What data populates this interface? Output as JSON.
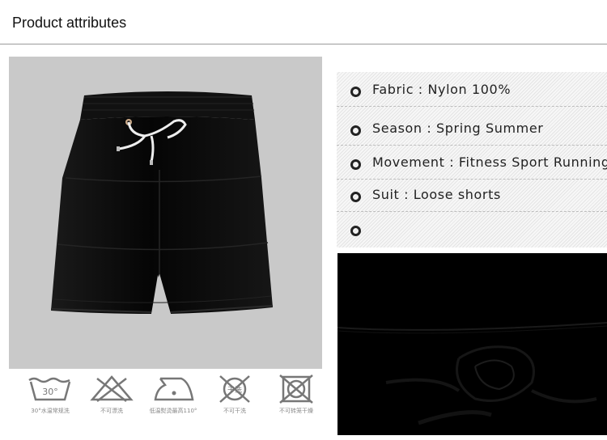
{
  "header": {
    "title": "Product attributes"
  },
  "attributes": [
    {
      "label": "Fabric : Nylon 100%"
    },
    {
      "label": "Season : Spring Summer"
    },
    {
      "label": "Movement : Fitness Sport Running"
    },
    {
      "label": "Suit : Loose shorts"
    },
    {
      "label": ""
    }
  ],
  "care": [
    {
      "icon": "wash-30-icon",
      "symbol": "30°",
      "label": "30°水温常规洗"
    },
    {
      "icon": "no-bleach-icon",
      "label": "不可漂洗"
    },
    {
      "icon": "low-iron-icon",
      "label": "低温熨烫最高110°"
    },
    {
      "icon": "no-dry-clean-icon",
      "symbol": "干洗",
      "label": "不可干洗"
    },
    {
      "icon": "no-tumble-dry-icon",
      "label": "不可转笼干燥"
    }
  ],
  "colors": {
    "product": "#0a0a0a",
    "photo_bg": "#c9c9c9",
    "divider": "#9a9a9a"
  }
}
